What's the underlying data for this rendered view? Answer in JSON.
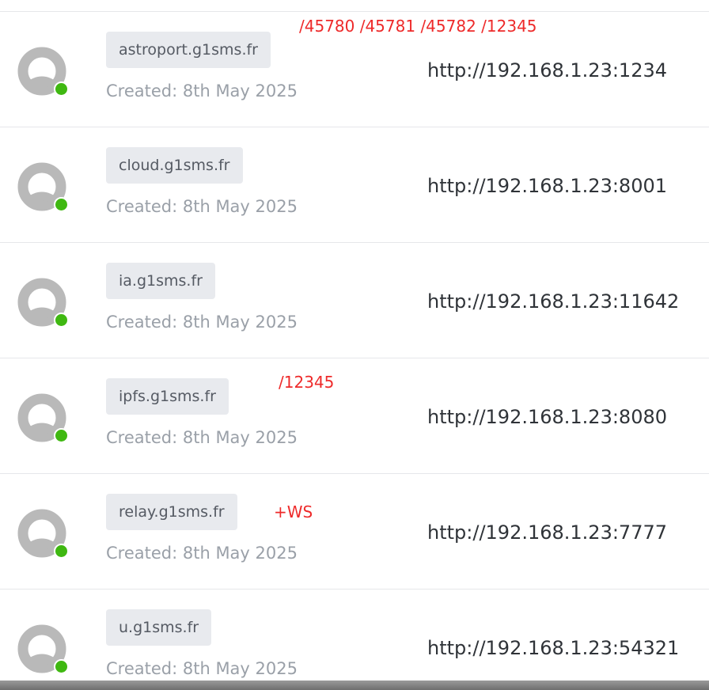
{
  "colors": {
    "online_status": "#3fb811",
    "annotation": "#ee2a2a",
    "badge_background": "#e8eaee",
    "divider": "#e6e7ea"
  },
  "hosts": [
    {
      "domain": "astroport.g1sms.fr",
      "created": "Created: 8th May 2025",
      "target": "http://192.168.1.23:1234",
      "status": "online",
      "avatar_icon": "default-user-icon"
    },
    {
      "domain": "cloud.g1sms.fr",
      "created": "Created: 8th May 2025",
      "target": "http://192.168.1.23:8001",
      "status": "online",
      "avatar_icon": "default-user-icon"
    },
    {
      "domain": "ia.g1sms.fr",
      "created": "Created: 8th May 2025",
      "target": "http://192.168.1.23:11642",
      "status": "online",
      "avatar_icon": "default-user-icon"
    },
    {
      "domain": "ipfs.g1sms.fr",
      "created": "Created: 8th May 2025",
      "target": "http://192.168.1.23:8080",
      "status": "online",
      "avatar_icon": "default-user-icon"
    },
    {
      "domain": "relay.g1sms.fr",
      "created": "Created: 8th May 2025",
      "target": "http://192.168.1.23:7777",
      "status": "online",
      "avatar_icon": "default-user-icon"
    },
    {
      "domain": "u.g1sms.fr",
      "created": "Created: 8th May 2025",
      "target": "http://192.168.1.23:54321",
      "status": "online",
      "avatar_icon": "default-user-icon"
    }
  ],
  "annotations": {
    "astroport_ports": "/45780 /45781 /45782 /12345",
    "ipfs_port": "/12345",
    "relay_ws": "+WS"
  }
}
